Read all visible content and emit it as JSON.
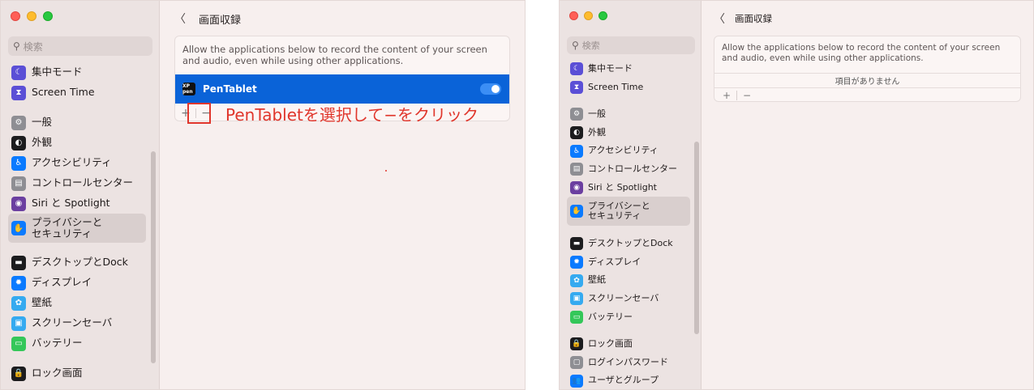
{
  "left": {
    "search_placeholder": "検索",
    "sidebar": [
      {
        "label": "集中モード",
        "icon": "moon-icon",
        "color": "#5b4fd6"
      },
      {
        "label": "Screen Time",
        "icon": "hourglass-icon",
        "color": "#5b4fd6"
      },
      {
        "label": "一般",
        "icon": "gear-icon",
        "color": "#8e8e93",
        "gap": true
      },
      {
        "label": "外観",
        "icon": "appearance-icon",
        "color": "#1c1c1e"
      },
      {
        "label": "アクセシビリティ",
        "icon": "accessibility-icon",
        "color": "#0a7aff"
      },
      {
        "label": "コントロールセンター",
        "icon": "control-center-icon",
        "color": "#8e8e93"
      },
      {
        "label": "Siri と Spotlight",
        "icon": "siri-icon",
        "color": "#6b3fa0"
      },
      {
        "label": "プライバシーと\nセキュリティ",
        "icon": "hand-icon",
        "color": "#0a7aff",
        "selected": true
      },
      {
        "label": "デスクトップとDock",
        "icon": "dock-icon",
        "color": "#1c1c1e",
        "gap": true
      },
      {
        "label": "ディスプレイ",
        "icon": "sun-icon",
        "color": "#0a7aff"
      },
      {
        "label": "壁紙",
        "icon": "wallpaper-icon",
        "color": "#35aaf0"
      },
      {
        "label": "スクリーンセーバ",
        "icon": "screensaver-icon",
        "color": "#35aaf0"
      },
      {
        "label": "バッテリー",
        "icon": "battery-icon",
        "color": "#34c759"
      },
      {
        "label": "ロック画面",
        "icon": "lock-icon",
        "color": "#1c1c1e",
        "gap": true
      }
    ],
    "page_title": "画面収録",
    "description": "Allow the applications below to record the content of your screen and audio, even while using other applications.",
    "app_name": "PenTablet",
    "app_logo_text": "XP pen",
    "plus": "+",
    "minus": "−",
    "annotation": "PenTabletを選択して−をクリック"
  },
  "right": {
    "search_placeholder": "検索",
    "sidebar": [
      {
        "label": "集中モード",
        "icon": "moon-icon",
        "color": "#5b4fd6"
      },
      {
        "label": "Screen Time",
        "icon": "hourglass-icon",
        "color": "#5b4fd6"
      },
      {
        "label": "一般",
        "icon": "gear-icon",
        "color": "#8e8e93",
        "gap": true
      },
      {
        "label": "外観",
        "icon": "appearance-icon",
        "color": "#1c1c1e"
      },
      {
        "label": "アクセシビリティ",
        "icon": "accessibility-icon",
        "color": "#0a7aff"
      },
      {
        "label": "コントロールセンター",
        "icon": "control-center-icon",
        "color": "#8e8e93"
      },
      {
        "label": "Siri と Spotlight",
        "icon": "siri-icon",
        "color": "#6b3fa0"
      },
      {
        "label": "プライバシーと\nセキュリティ",
        "icon": "hand-icon",
        "color": "#0a7aff",
        "selected": true
      },
      {
        "label": "デスクトップとDock",
        "icon": "dock-icon",
        "color": "#1c1c1e",
        "gap": true
      },
      {
        "label": "ディスプレイ",
        "icon": "sun-icon",
        "color": "#0a7aff"
      },
      {
        "label": "壁紙",
        "icon": "wallpaper-icon",
        "color": "#35aaf0"
      },
      {
        "label": "スクリーンセーバ",
        "icon": "screensaver-icon",
        "color": "#35aaf0"
      },
      {
        "label": "バッテリー",
        "icon": "battery-icon",
        "color": "#34c759"
      },
      {
        "label": "ロック画面",
        "icon": "lock-icon",
        "color": "#1c1c1e",
        "gap": true
      },
      {
        "label": "ログインパスワード",
        "icon": "password-icon",
        "color": "#8e8e93"
      },
      {
        "label": "ユーザとグループ",
        "icon": "users-icon",
        "color": "#0a7aff"
      }
    ],
    "page_title": "画面収録",
    "description": "Allow the applications below to record the content of your screen and audio, even while using other applications.",
    "empty_text": "項目がありません",
    "plus": "+",
    "minus": "−"
  }
}
